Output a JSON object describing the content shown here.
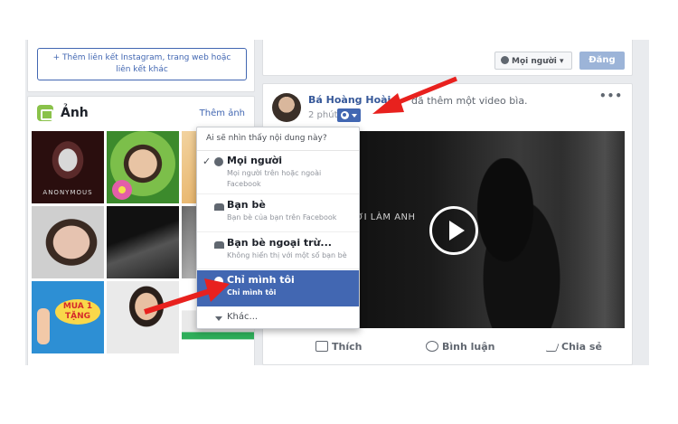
{
  "left": {
    "add_link": "Thêm liên kết Instagram, trang web hoặc liên kết khác",
    "photos": {
      "title": "Ảnh",
      "more": "Thêm ảnh",
      "tiles": [
        {
          "caption": "ANONYMOUS"
        },
        {
          "caption": ""
        },
        {
          "caption": ""
        },
        {
          "caption": ""
        },
        {
          "caption": ""
        },
        {
          "caption": ""
        },
        {
          "caption": "MUA 1 TẶNG"
        },
        {
          "caption": ""
        },
        {
          "caption": ""
        }
      ]
    }
  },
  "composer": {
    "privacy": "Mọi người",
    "post": "Đăng"
  },
  "post": {
    "author": "Bá Hoàng Hoài",
    "action": "đã thêm một video bìa.",
    "time": "2 phút",
    "more": "•••",
    "video_text": "ỜI LÀM ANH",
    "actions": {
      "like": "Thích",
      "comment": "Bình luận",
      "share": "Chia sẻ"
    }
  },
  "menu": {
    "header": "Ai sẽ nhìn thấy nội dung này?",
    "items": [
      {
        "title": "Mọi người",
        "sub": "Mọi người trên hoặc ngoài Facebook",
        "icon": "globe-icon",
        "checked": true
      },
      {
        "title": "Bạn bè",
        "sub": "Bạn bè của bạn trên Facebook",
        "icon": "friends-icon"
      },
      {
        "title": "Bạn bè ngoại trừ...",
        "sub": "Không hiển thị với một số bạn bè",
        "icon": "friends-except-icon"
      },
      {
        "title": "Chỉ mình tôi",
        "sub": "Chỉ mình tôi",
        "icon": "lock-icon",
        "selected": true
      },
      {
        "title": "Khác...",
        "icon": "chevron-down-icon"
      }
    ],
    "check": "✓"
  },
  "colors": {
    "facebook_blue": "#4267b2",
    "arrow_red": "#e8211e"
  }
}
